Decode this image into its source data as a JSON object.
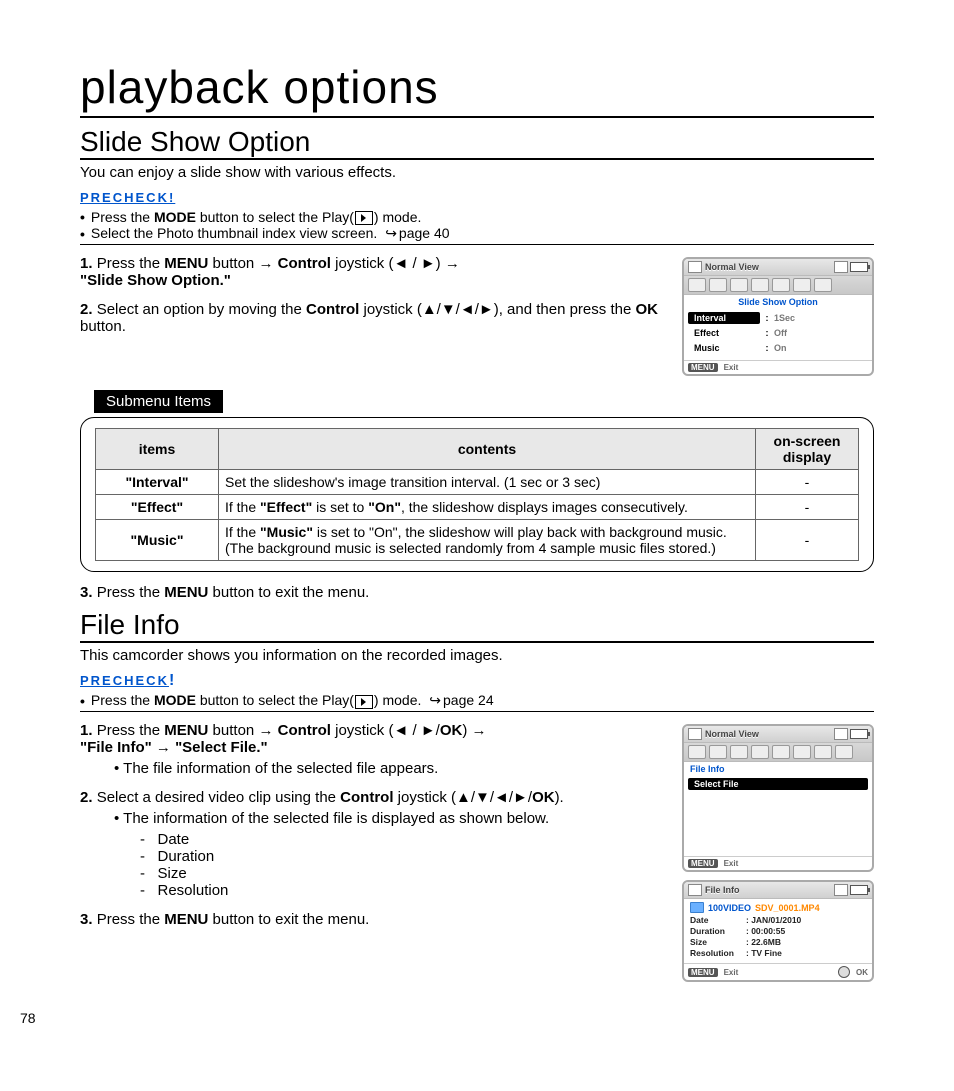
{
  "page_number": "78",
  "chapter_title": "playback options",
  "slide_show": {
    "heading": "Slide Show Option",
    "intro": "You can enjoy a slide show with various effects.",
    "precheck_label": "PRECHECK!",
    "precheck": [
      {
        "pre": "Press the ",
        "bold1": "MODE",
        "mid": " button to select the Play(",
        "post": ") mode."
      },
      {
        "pre": "Select the Photo thumbnail index view screen. ",
        "pageref": "page 40"
      }
    ],
    "steps": {
      "s1a": "Press the ",
      "s1b": "MENU",
      "s1c": " button ",
      "s1d": "Control",
      "s1e": " joystick (◄ / ►) ",
      "s1f": "\"Slide Show Option.\"",
      "s2a": "Select an option by moving the ",
      "s2b": "Control",
      "s2c": " joystick (▲/▼/◄/►), and then press the ",
      "s2d": "OK",
      "s2e": " button.",
      "s3a": "Press the ",
      "s3b": "MENU",
      "s3c": " button to exit the menu."
    },
    "submenu_title": "Submenu Items",
    "table": {
      "head": {
        "items": "items",
        "contents": "contents",
        "osd": "on-screen display"
      },
      "rows": [
        {
          "item": "\"Interval\"",
          "content_plain": "Set the slideshow's image transition interval. (1 sec or 3 sec)",
          "osd": "-"
        },
        {
          "item": "\"Effect\"",
          "content_pre": "If the ",
          "content_b1": "\"Effect\"",
          "content_mid": " is set to ",
          "content_b2": "\"On\"",
          "content_post": ", the slideshow displays images consecutively.",
          "osd": "-"
        },
        {
          "item": "\"Music\"",
          "content_pre": "If the ",
          "content_b1": "\"Music\"",
          "content_mid": " is set to \"On\", the slideshow will play back with background music. (The background music is selected randomly from 4 sample music files stored.)",
          "osd": "-"
        }
      ]
    },
    "lcd": {
      "title": "Normal View",
      "highlight": "Slide Show Option",
      "items": [
        {
          "label": "Interval",
          "value": "1Sec"
        },
        {
          "label": "Effect",
          "value": "Off"
        },
        {
          "label": "Music",
          "value": "On"
        }
      ],
      "footer_menu": "MENU",
      "footer_exit": "Exit"
    }
  },
  "file_info": {
    "heading": "File Info",
    "intro": "This camcorder shows you information on the recorded images.",
    "precheck_label": "PRECHECK",
    "precheck_bang": "!",
    "precheck_line": {
      "pre": "Press the ",
      "bold1": "MODE",
      "mid": " button to select the Play(",
      "post": ") mode. ",
      "pageref": "page 24"
    },
    "steps": {
      "s1a": "Press the ",
      "s1b": "MENU",
      "s1c": " button ",
      "s1d": "Control",
      "s1e": " joystick (◄ / ►/",
      "s1ok": "OK",
      "s1f": ") ",
      "s1g": "\"File Info\"",
      "s1h": "\"Select File.\"",
      "sub1": "The file information of the selected file appears.",
      "s2a": "Select a desired video clip using the ",
      "s2b": "Control",
      "s2c": " joystick (▲/▼/◄/►/",
      "s2ok": "OK",
      "s2d": ").",
      "sub2": "The information of the selected file is displayed as shown below.",
      "dashes": [
        "Date",
        "Duration",
        "Size",
        "Resolution"
      ],
      "s3a": "Press the ",
      "s3b": "MENU",
      "s3c": " button to exit the menu."
    },
    "lcd1": {
      "title": "Normal View",
      "highlight": "File Info",
      "select_file": "Select File",
      "footer_menu": "MENU",
      "footer_exit": "Exit"
    },
    "lcd2": {
      "title": "File Info",
      "folder": "100VIDEO",
      "filename": "SDV_0001.MP4",
      "rows": [
        {
          "k": "Date",
          "v": ": JAN/01/2010"
        },
        {
          "k": "Duration",
          "v": ": 00:00:55"
        },
        {
          "k": "Size",
          "v": ": 22.6MB"
        },
        {
          "k": "Resolution",
          "v": ": TV Fine"
        }
      ],
      "footer_menu": "MENU",
      "footer_exit": "Exit",
      "footer_ok": "OK"
    }
  }
}
